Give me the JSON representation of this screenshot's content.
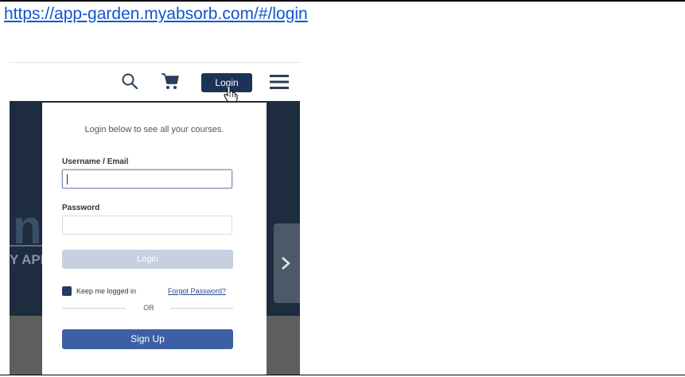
{
  "document": {
    "url_text": "https://app-garden.myabsorb.com/#/login"
  },
  "header": {
    "login_label": "Login"
  },
  "hero": {
    "large_text": "n",
    "sub_text": "Y APP"
  },
  "login_panel": {
    "intro": "Login below to see all your courses.",
    "username_label": "Username / Email",
    "username_value": "",
    "password_label": "Password",
    "password_value": "",
    "submit_label": "Login",
    "keep_logged_in_label": "Keep me logged in",
    "keep_logged_in_checked": true,
    "forgot_password": "Forgot Password?",
    "or_text": "OR",
    "signup_label": "Sign Up"
  },
  "colors": {
    "header_button": "#1c3358",
    "hero_background": "#1d2c3e",
    "submit_disabled": "#c5d0e0",
    "signup_button": "#3d5fa3",
    "link": "#1155cc"
  },
  "icons": [
    "search-icon",
    "cart-icon",
    "hand-cursor-icon",
    "hamburger-menu-icon",
    "chevron-right-icon"
  ]
}
